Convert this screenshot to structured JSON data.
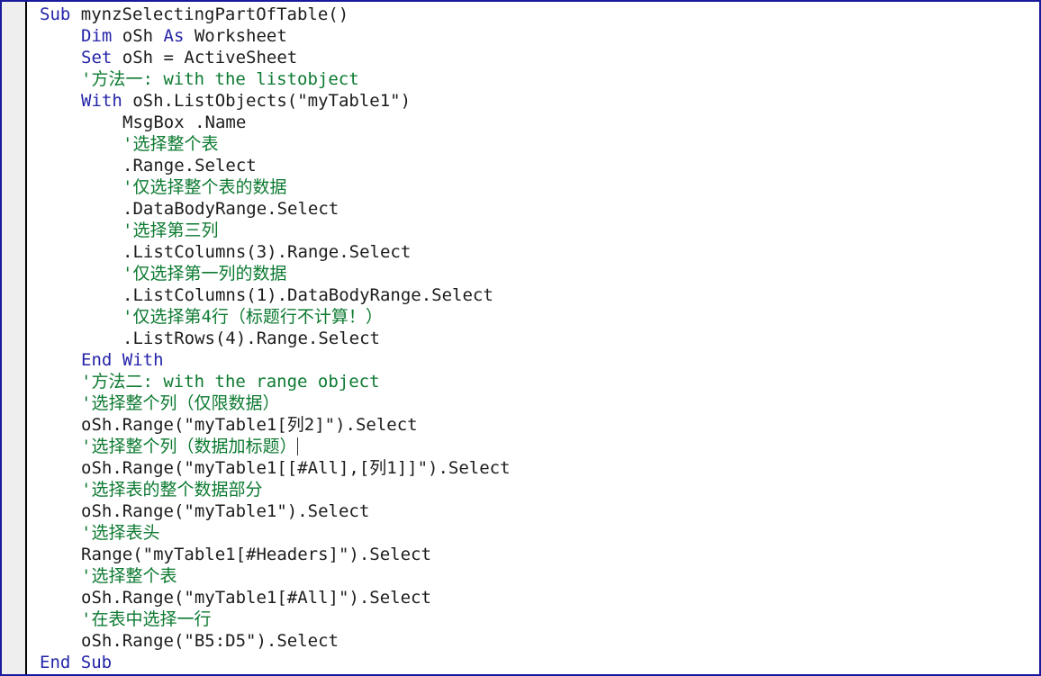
{
  "window": {
    "title": "VBA Code Module",
    "border_color": "#1a1a9c",
    "gutter_color": "#eeeeee",
    "background_color": "#ffffff"
  },
  "syntax_colors": {
    "keyword": "#2424a8",
    "plain": "#1c1c1c",
    "comment": "#0d7a31"
  },
  "code": {
    "lines": [
      {
        "indent": 0,
        "tokens": [
          {
            "t": "Sub",
            "c": "keyword"
          },
          {
            "t": " mynzSelectingPartOfTable()",
            "c": "plain"
          }
        ]
      },
      {
        "indent": 1,
        "tokens": [
          {
            "t": "Dim",
            "c": "keyword"
          },
          {
            "t": " oSh ",
            "c": "plain"
          },
          {
            "t": "As",
            "c": "keyword"
          },
          {
            "t": " Worksheet",
            "c": "plain"
          }
        ]
      },
      {
        "indent": 1,
        "tokens": [
          {
            "t": "Set",
            "c": "keyword"
          },
          {
            "t": " oSh = ActiveSheet",
            "c": "plain"
          }
        ]
      },
      {
        "indent": 1,
        "tokens": [
          {
            "t": "'方法一: with the listobject",
            "c": "comment"
          }
        ]
      },
      {
        "indent": 1,
        "tokens": [
          {
            "t": "With",
            "c": "keyword"
          },
          {
            "t": " oSh.ListObjects(\"myTable1\")",
            "c": "plain"
          }
        ]
      },
      {
        "indent": 2,
        "tokens": [
          {
            "t": "MsgBox .Name",
            "c": "plain"
          }
        ]
      },
      {
        "indent": 2,
        "tokens": [
          {
            "t": "'选择整个表",
            "c": "comment"
          }
        ]
      },
      {
        "indent": 2,
        "tokens": [
          {
            "t": ".Range.Select",
            "c": "plain"
          }
        ]
      },
      {
        "indent": 2,
        "tokens": [
          {
            "t": "'仅选择整个表的数据",
            "c": "comment"
          }
        ]
      },
      {
        "indent": 2,
        "tokens": [
          {
            "t": ".DataBodyRange.Select",
            "c": "plain"
          }
        ]
      },
      {
        "indent": 2,
        "tokens": [
          {
            "t": "'选择第三列",
            "c": "comment"
          }
        ]
      },
      {
        "indent": 2,
        "tokens": [
          {
            "t": ".ListColumns(3).Range.Select",
            "c": "plain"
          }
        ]
      },
      {
        "indent": 2,
        "tokens": [
          {
            "t": "'仅选择第一列的数据",
            "c": "comment"
          }
        ]
      },
      {
        "indent": 2,
        "tokens": [
          {
            "t": ".ListColumns(1).DataBodyRange.Select",
            "c": "plain"
          }
        ]
      },
      {
        "indent": 2,
        "tokens": [
          {
            "t": "'仅选择第4行（标题行不计算！）",
            "c": "comment"
          }
        ]
      },
      {
        "indent": 2,
        "tokens": [
          {
            "t": ".ListRows(4).Range.Select",
            "c": "plain"
          }
        ]
      },
      {
        "indent": 1,
        "tokens": [
          {
            "t": "End With",
            "c": "keyword"
          }
        ]
      },
      {
        "indent": 1,
        "tokens": [
          {
            "t": "'方法二: with the range object",
            "c": "comment"
          }
        ]
      },
      {
        "indent": 1,
        "tokens": [
          {
            "t": "'选择整个列（仅限数据）",
            "c": "comment"
          }
        ]
      },
      {
        "indent": 1,
        "tokens": [
          {
            "t": "oSh.Range(\"myTable1[列2]\").Select",
            "c": "plain"
          }
        ]
      },
      {
        "indent": 1,
        "caret": true,
        "tokens": [
          {
            "t": "'选择整个列（数据加标题）",
            "c": "comment"
          }
        ]
      },
      {
        "indent": 1,
        "tokens": [
          {
            "t": "oSh.Range(\"myTable1[[#All],[列1]]\").Select",
            "c": "plain"
          }
        ]
      },
      {
        "indent": 1,
        "tokens": [
          {
            "t": "'选择表的整个数据部分",
            "c": "comment"
          }
        ]
      },
      {
        "indent": 1,
        "tokens": [
          {
            "t": "oSh.Range(\"myTable1\").Select",
            "c": "plain"
          }
        ]
      },
      {
        "indent": 1,
        "tokens": [
          {
            "t": "'选择表头",
            "c": "comment"
          }
        ]
      },
      {
        "indent": 1,
        "tokens": [
          {
            "t": "Range(\"myTable1[#Headers]\").Select",
            "c": "plain"
          }
        ]
      },
      {
        "indent": 1,
        "tokens": [
          {
            "t": "'选择整个表",
            "c": "comment"
          }
        ]
      },
      {
        "indent": 1,
        "tokens": [
          {
            "t": "oSh.Range(\"myTable1[#All]\").Select",
            "c": "plain"
          }
        ]
      },
      {
        "indent": 1,
        "tokens": [
          {
            "t": "'在表中选择一行",
            "c": "comment"
          }
        ]
      },
      {
        "indent": 1,
        "tokens": [
          {
            "t": "oSh.Range(\"B5:D5\").Select",
            "c": "plain"
          }
        ]
      },
      {
        "indent": 0,
        "tokens": [
          {
            "t": "End Sub",
            "c": "keyword"
          }
        ]
      }
    ]
  }
}
